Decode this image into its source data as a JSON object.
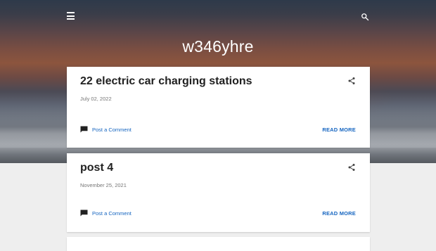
{
  "header": {
    "blog_title": "w346yhre"
  },
  "icons": {
    "menu": "menu-icon",
    "search": "search-icon",
    "share": "share-icon",
    "comment": "comment-icon"
  },
  "colors": {
    "link": "#1565c0",
    "title": "#212121",
    "date": "#757575"
  },
  "posts": [
    {
      "title": "22 electric car charging stations",
      "date": "July 02, 2022",
      "comment_label": "Post a Comment",
      "read_more": "READ MORE"
    },
    {
      "title": "post 4",
      "date": "November 25, 2021",
      "comment_label": "Post a Comment",
      "read_more": "READ MORE"
    }
  ]
}
